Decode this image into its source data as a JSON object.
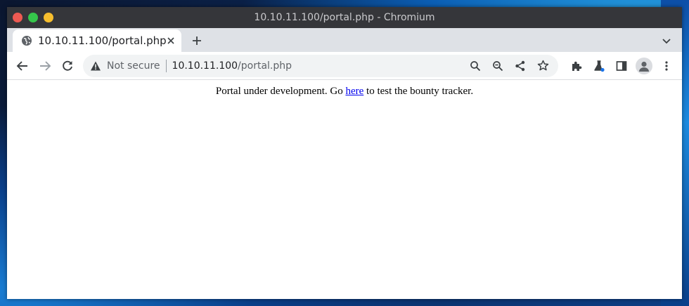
{
  "window": {
    "title": "10.10.11.100/portal.php - Chromium"
  },
  "tab": {
    "title": "10.10.11.100/portal.php",
    "close_icon": "close-icon",
    "favicon": "globe-icon"
  },
  "toolbar": {
    "security_label": "Not secure",
    "url_host": "10.10.11.100",
    "url_path": "/portal.php"
  },
  "page": {
    "text_before": "Portal under development. Go ",
    "link_text": "here",
    "text_after": " to test the bounty tracker."
  },
  "colors": {
    "titlebar": "#35363a",
    "tabstrip": "#dee1e6",
    "link": "#0000ee",
    "close_dot": "#ee5a52",
    "minimize_dot": "#35c64b",
    "maximize_dot": "#f6be2e"
  }
}
